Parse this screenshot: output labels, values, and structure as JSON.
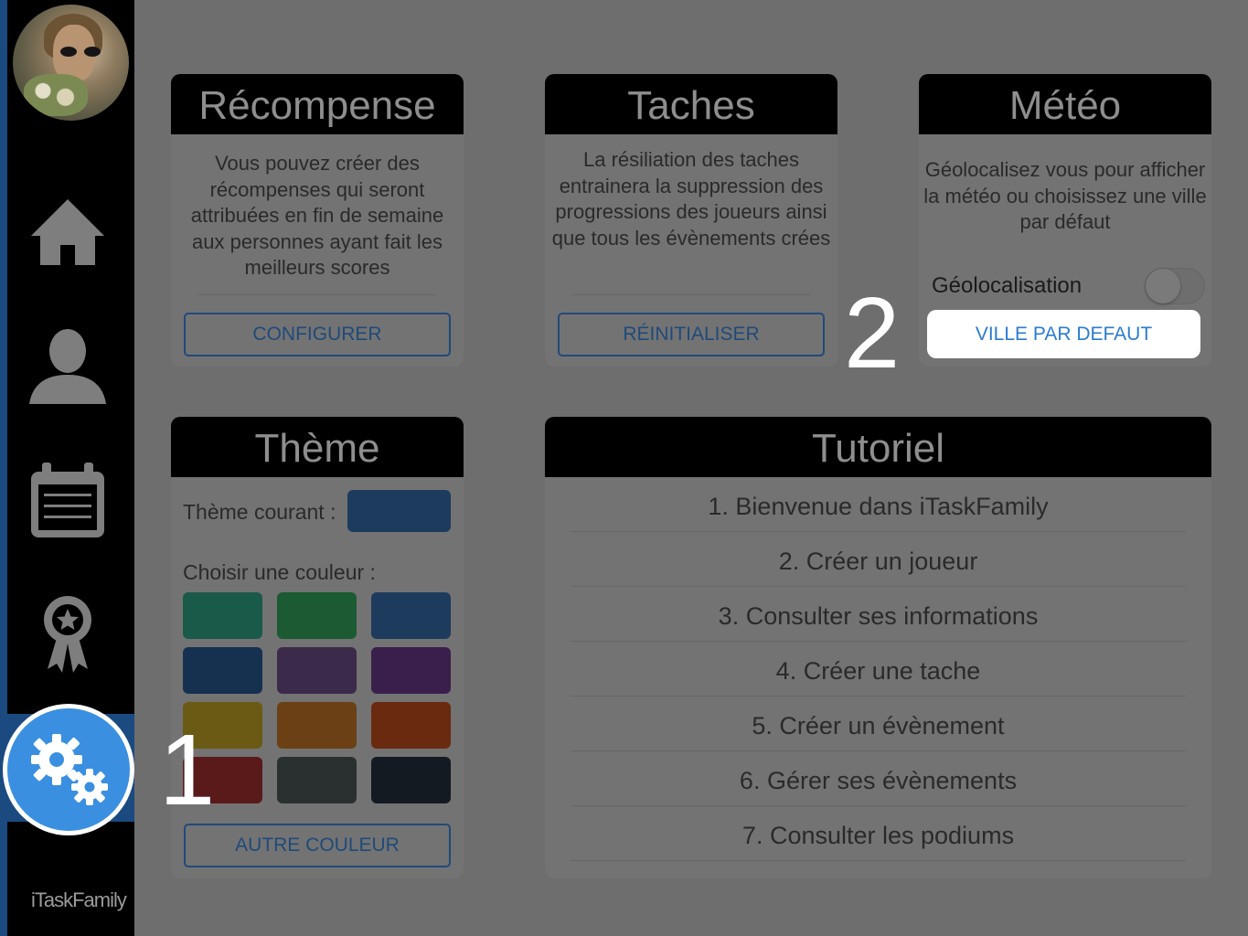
{
  "sidebar": {
    "brand": "iTaskFamily",
    "items": [
      {
        "icon": "home-icon"
      },
      {
        "icon": "user-icon"
      },
      {
        "icon": "calendar-icon"
      },
      {
        "icon": "award-icon"
      },
      {
        "icon": "gears-icon"
      }
    ]
  },
  "recompense": {
    "title": "Récompense",
    "text": "Vous pouvez créer des récompenses qui seront attribuées en fin de semaine aux personnes ayant fait les meilleurs scores",
    "button": "CONFIGURER"
  },
  "taches": {
    "title": "Taches",
    "text": "La résiliation des taches entrainera la suppression des progressions des joueurs ainsi que tous les évènements crées",
    "button": "RÉINITIALISER"
  },
  "meteo": {
    "title": "Météo",
    "text": "Géolocalisez vous pour afficher la météo ou choisissez une ville par défaut",
    "geoloc_label": "Géolocalisation",
    "geoloc_enabled": false,
    "button": "VILLE PAR DEFAUT"
  },
  "theme": {
    "title": "Thème",
    "current_label": "Thème courant :",
    "choose_label": "Choisir une couleur :",
    "button": "AUTRE COULEUR",
    "current_color": "#1d3b5d",
    "colors": [
      "#1a5a48",
      "#1b5a32",
      "#1d3b5d",
      "#163050",
      "#3c2a4a",
      "#3a1f4c",
      "#6a5a14",
      "#6a4014",
      "#6a2a10",
      "#5a1a1a",
      "#2a3030",
      "#141a22"
    ]
  },
  "tutoriel": {
    "title": "Tutoriel",
    "items": [
      "1. Bienvenue dans iTaskFamily",
      "2. Créer un joueur",
      "3. Consulter ses informations",
      "4. Créer une tache",
      "5. Créer un évènement",
      "6. Gérer ses évènements",
      "7. Consulter les podiums"
    ]
  },
  "annotations": {
    "step1": "1",
    "step2": "2"
  },
  "colors": {
    "accent": "#3a8fe0",
    "sidebar_highlight": "#1a4a80",
    "button_outline": "#1f4a7a",
    "link_blue": "#2b7bd0"
  }
}
